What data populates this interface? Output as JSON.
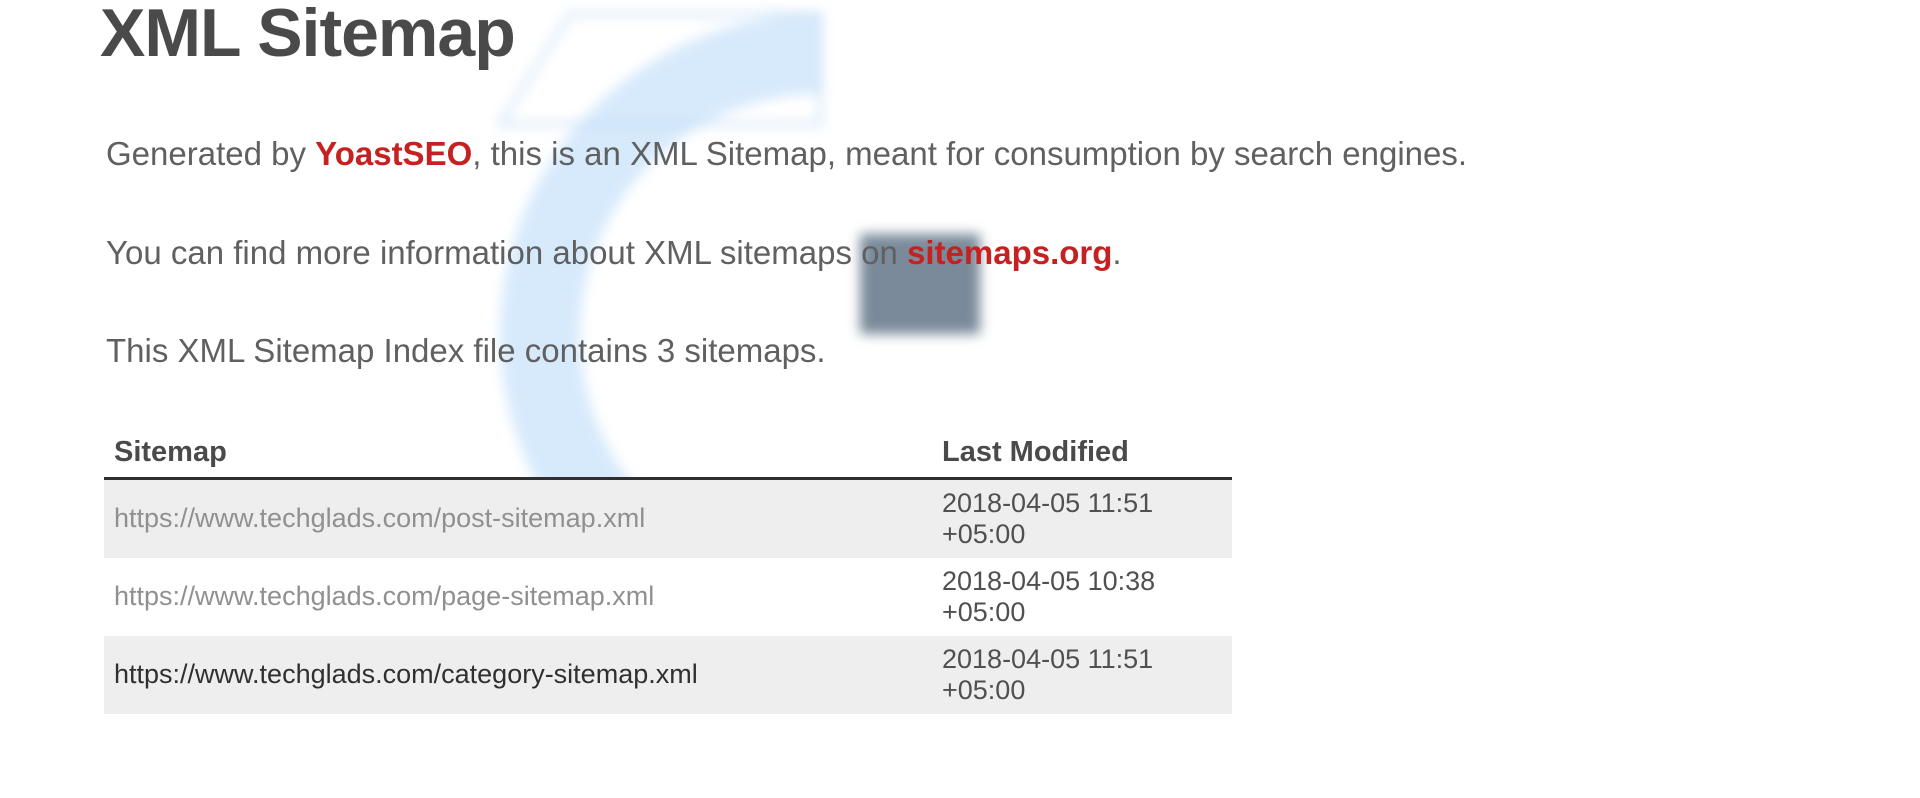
{
  "heading": "XML Sitemap",
  "intro": {
    "prefix": "Generated by ",
    "link_text": "YoastSEO",
    "suffix": ", this is an XML Sitemap, meant for consumption by search engines."
  },
  "info": {
    "prefix": "You can find more information about XML sitemaps on ",
    "link_text": "sitemaps.org",
    "suffix": "."
  },
  "count_text": "This XML Sitemap Index file contains 3 sitemaps.",
  "table": {
    "col_sitemap": "Sitemap",
    "col_modified": "Last Modified",
    "rows": [
      {
        "url": "https://www.techglads.com/post-sitemap.xml",
        "modified": "2018-04-05 11:51 +05:00"
      },
      {
        "url": "https://www.techglads.com/page-sitemap.xml",
        "modified": "2018-04-05 10:38 +05:00"
      },
      {
        "url": "https://www.techglads.com/category-sitemap.xml",
        "modified": "2018-04-05 11:51 +05:00"
      }
    ]
  }
}
